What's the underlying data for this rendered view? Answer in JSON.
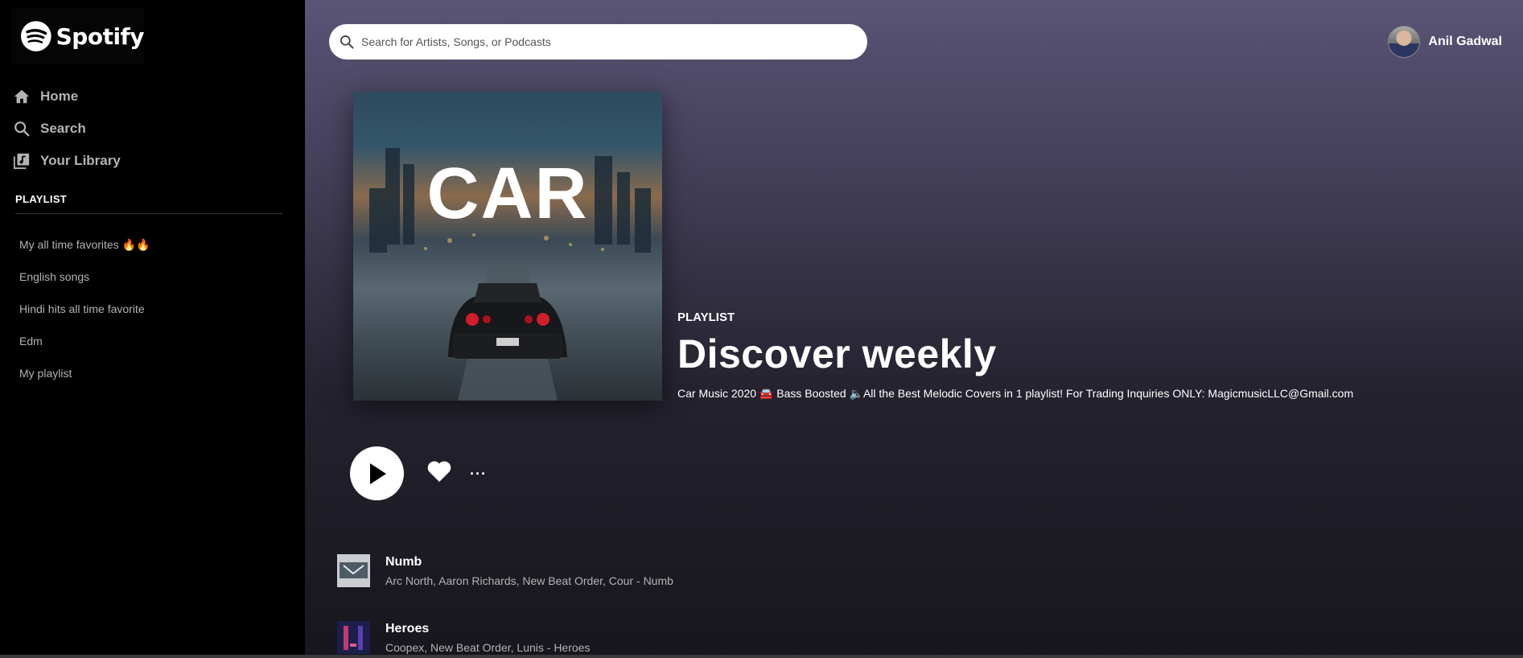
{
  "brand": {
    "name": "Spotify"
  },
  "sidebar": {
    "nav": [
      {
        "label": "Home",
        "icon": "home-icon"
      },
      {
        "label": "Search",
        "icon": "search-icon"
      },
      {
        "label": "Your Library",
        "icon": "library-icon"
      }
    ],
    "section_title": "PLAYLIST",
    "playlists": [
      "My all time favorites 🔥🔥",
      "English songs",
      "Hindi hits all time favorite",
      "Edm",
      "My playlist"
    ]
  },
  "header": {
    "search_placeholder": "Search for Artists, Songs, or Podcasts",
    "user_name": "Anil Gadwal"
  },
  "playlist": {
    "cover_text": "CAR",
    "type": "PLAYLIST",
    "title": "Discover weekly",
    "description": "Car Music 2020 🚘 Bass Boosted 🔈All the Best Melodic Covers in 1 playlist! For Trading Inquiries ONLY: MagicmusicLLC@Gmail.com"
  },
  "controls": {
    "more_label": "···"
  },
  "tracks": [
    {
      "name": "Numb",
      "artists": "Arc North, Aaron Richards, New Beat Order, Cour - Numb"
    },
    {
      "name": "Heroes",
      "artists": "Coopex, New Beat Order, Lunis - Heroes"
    }
  ],
  "colors": {
    "sidebar_bg": "#000000",
    "main_gradient_top": "#5a5476",
    "main_gradient_bottom": "#17161d",
    "muted_text": "#b3b3b3"
  }
}
